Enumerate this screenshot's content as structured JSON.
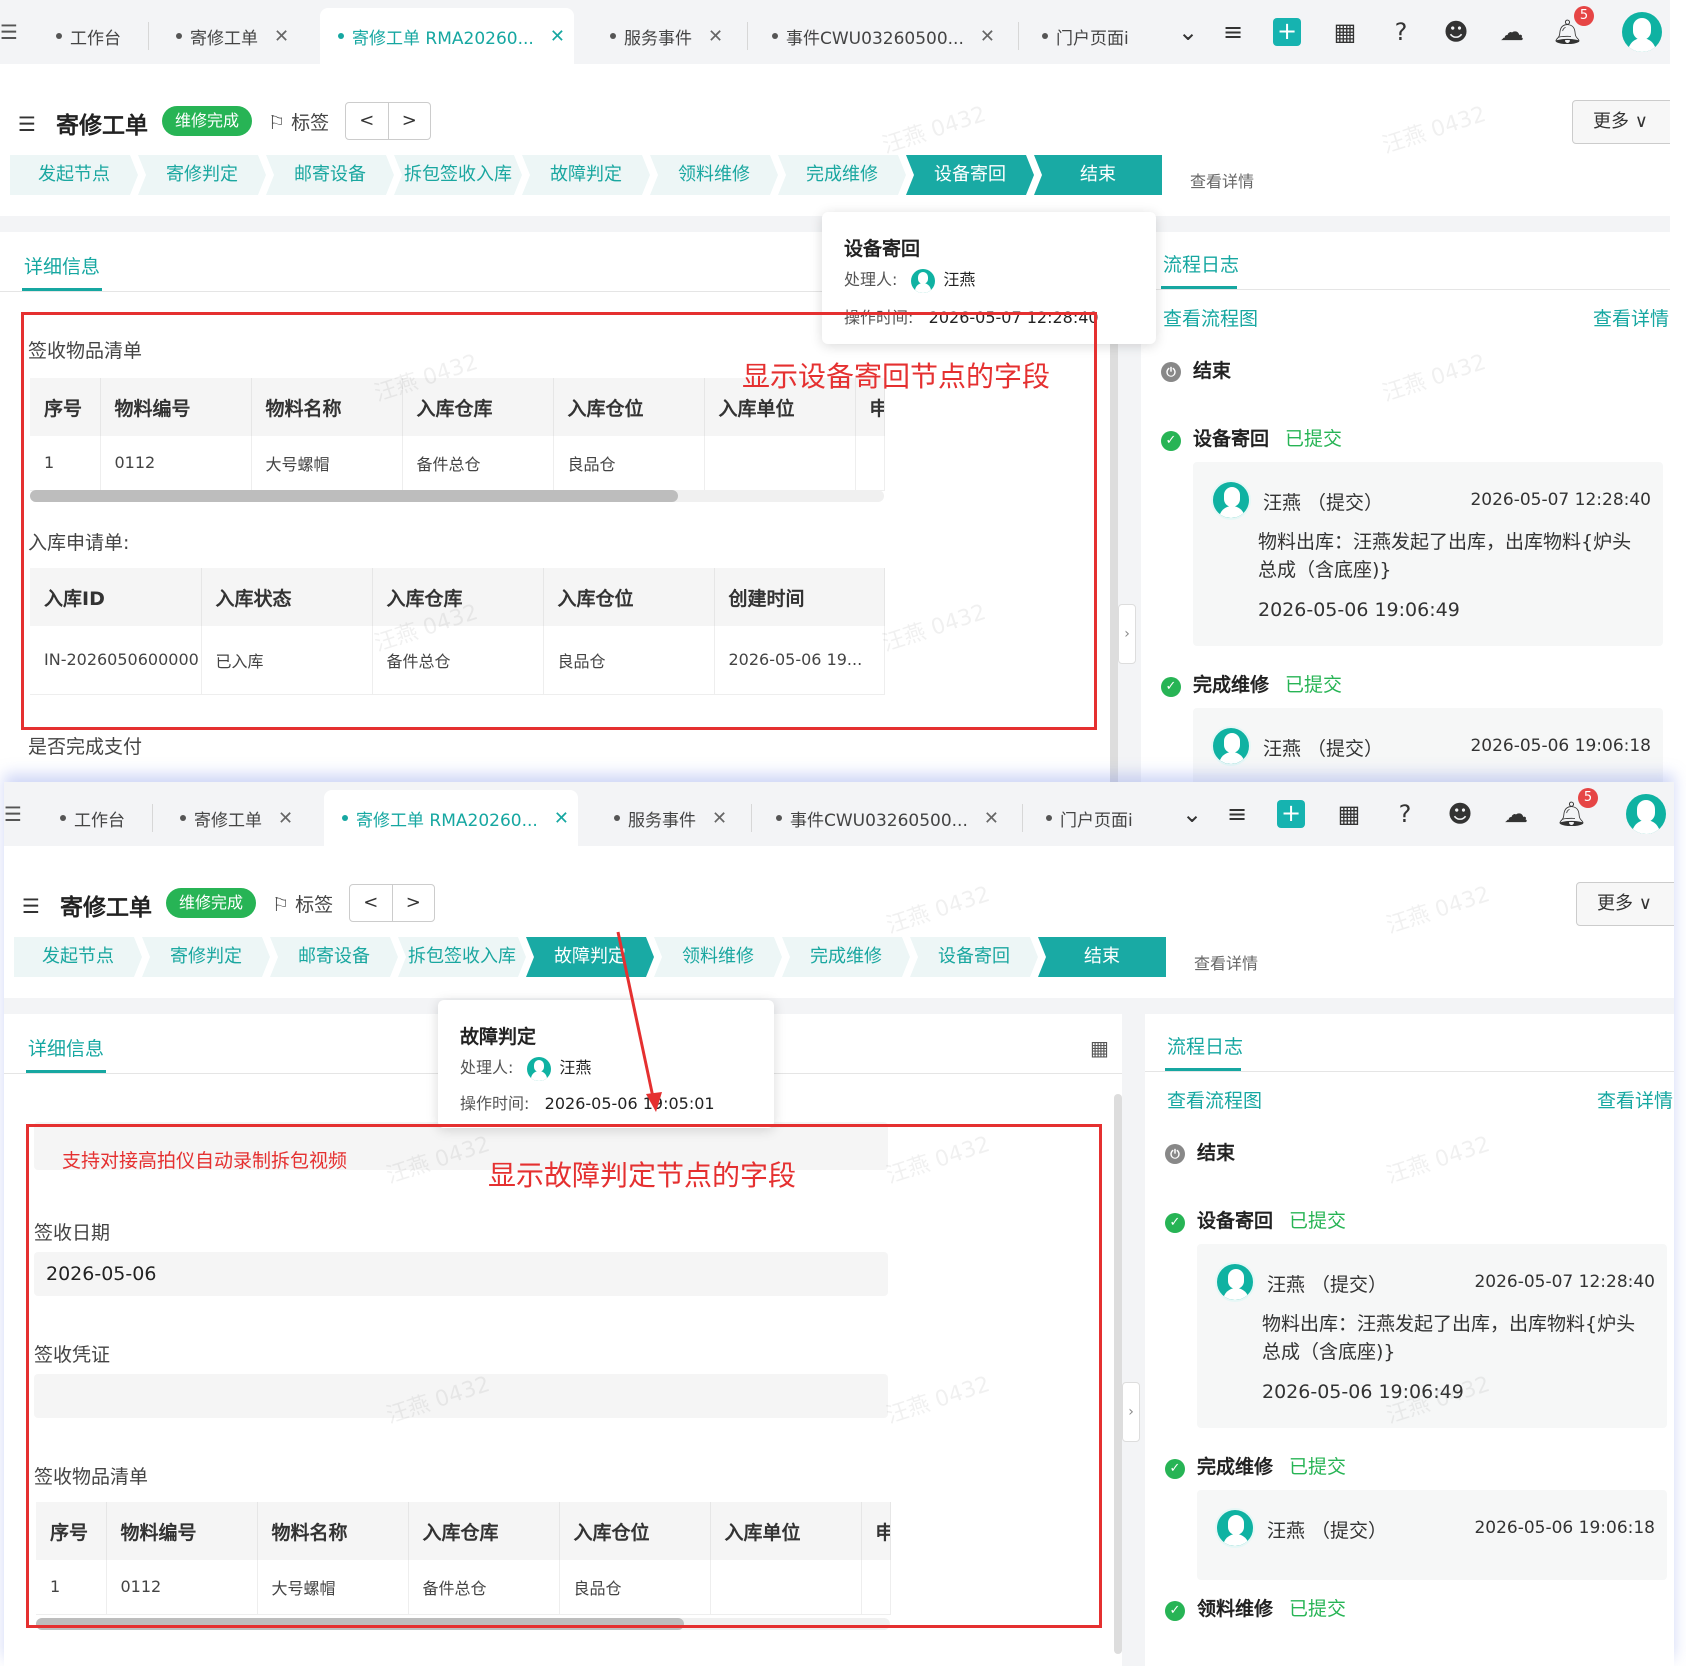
{
  "tabs": [
    {
      "label": "工作台",
      "close": false
    },
    {
      "label": "寄修工单",
      "close": true
    },
    {
      "label": "寄修工单 RMA20260...",
      "close": true,
      "active": true
    },
    {
      "label": "服务事件",
      "close": true
    },
    {
      "label": "事件CWU03260500...",
      "close": true
    },
    {
      "label": "门户页面i",
      "close": false
    }
  ],
  "toolbar": {
    "notification_count": "5"
  },
  "header": {
    "title": "寄修工单",
    "status": "维修完成",
    "tag_label": "标签",
    "prev": "<",
    "next": ">",
    "more": "更多 ∨",
    "view_detail": "查看详情"
  },
  "steps": [
    "发起节点",
    "寄修判定",
    "邮寄设备",
    "拆包签收入库",
    "故障判定",
    "领料维修",
    "完成维修",
    "设备寄回",
    "结束"
  ],
  "left": {
    "tab": "详细信息",
    "receipt_list_title": "签收物品清单",
    "receipt_columns": [
      "序号",
      "物料编号",
      "物料名称",
      "入库仓库",
      "入库仓位",
      "入库单位",
      "申"
    ],
    "receipt_rows": [
      [
        "1",
        "0112",
        "大号螺帽",
        "备件总仓",
        "良品仓",
        "",
        ""
      ]
    ],
    "inbound_title": "入库申请单:",
    "inbound_columns": [
      "入库ID",
      "入库状态",
      "入库仓库",
      "入库仓位",
      "创建时间"
    ],
    "inbound_rows": [
      [
        "IN-2026050600000",
        "已入库",
        "备件总仓",
        "良品仓",
        "2026-05-06 19..."
      ]
    ],
    "payment_label": "是否完成支付",
    "sign_date_label": "签收日期",
    "sign_date_value": "2026-05-06",
    "sign_proof_label": "签收凭证"
  },
  "popover1": {
    "title": "设备寄回",
    "handler_label": "处理人:",
    "handler": "汪燕",
    "time_label": "操作时间:",
    "time": "2026-05-07 12:28:40"
  },
  "popover2": {
    "title": "故障判定",
    "handler_label": "处理人:",
    "handler": "汪燕",
    "time_label": "操作时间:",
    "time": "2026-05-06 19:05:01"
  },
  "annotations": {
    "a1": "显示设备寄回节点的字段",
    "a2": "显示故障判定节点的字段",
    "a3": "支持对接高拍仪自动录制拆包视频"
  },
  "right": {
    "tab": "流程日志",
    "flow_chart": "查看流程图",
    "view_detail": "查看详情",
    "end_label": "结束",
    "logs": [
      {
        "node": "设备寄回",
        "status": "已提交",
        "user": "汪燕 （提交）",
        "time": "2026-05-07 12:28:40",
        "msg": "物料出库：汪燕发起了出库，出库物料{炉头总成（含底座)}",
        "msg_time": "2026-05-06 19:06:49"
      },
      {
        "node": "完成维修",
        "status": "已提交",
        "user": "汪燕 （提交）",
        "time": "2026-05-06 19:06:18"
      },
      {
        "node": "领料维修",
        "status": "已提交"
      }
    ]
  },
  "watermark": "汪燕 0432",
  "colors": {
    "accent": "#16a7a1",
    "status_green": "#27b455",
    "annotation_red": "#e53030"
  }
}
